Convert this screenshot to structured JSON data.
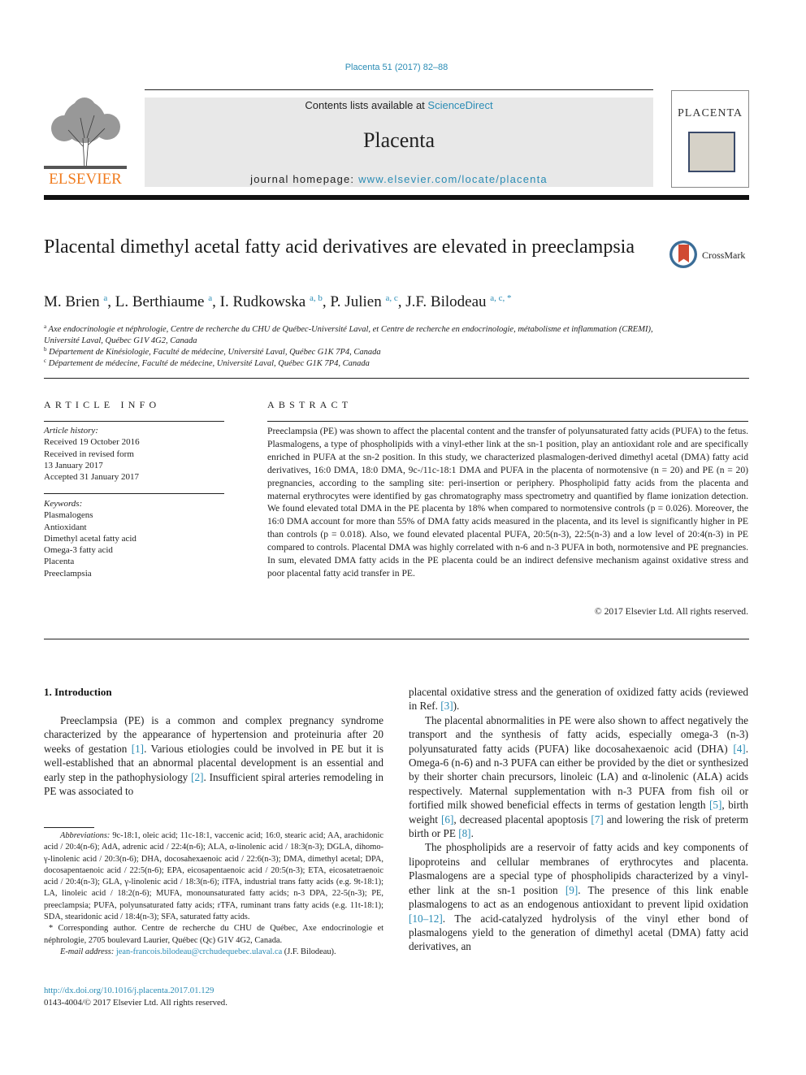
{
  "header": {
    "journal_ref": "Placenta 51 (2017) 82–88",
    "contents_prefix": "Contents lists available at ",
    "contents_link": "ScienceDirect",
    "journal_title": "Placenta",
    "homepage_prefix": "journal homepage: ",
    "homepage_link": "www.elsevier.com/locate/placenta",
    "publisher_logo": "ELSEVIER",
    "cover_title": "PLACENTA",
    "crossmark_label": "CrossMark"
  },
  "article": {
    "title": "Placental dimethyl acetal fatty acid derivatives are elevated in preeclampsia",
    "authors": [
      {
        "name": "M. Brien",
        "sup": "a"
      },
      {
        "name": "L. Berthiaume",
        "sup": "a"
      },
      {
        "name": "I. Rudkowska",
        "sup": "a, b"
      },
      {
        "name": "P. Julien",
        "sup": "a, c"
      },
      {
        "name": "J.F. Bilodeau",
        "sup": "a, c, *"
      }
    ],
    "affiliations": [
      {
        "mark": "a",
        "text": "Axe endocrinologie et néphrologie, Centre de recherche du CHU de Québec-Université Laval, et Centre de recherche en endocrinologie, métabolisme et inflammation (CREMI), Université Laval, Québec G1V 4G2, Canada"
      },
      {
        "mark": "b",
        "text": "Département de Kinésiologie, Faculté de médecine, Université Laval, Québec G1K 7P4, Canada"
      },
      {
        "mark": "c",
        "text": "Département de médecine, Faculté de médecine, Université Laval, Québec G1K 7P4, Canada"
      }
    ]
  },
  "article_info": {
    "heading": "ARTICLE INFO",
    "history_label": "Article history:",
    "history": [
      "Received 19 October 2016",
      "Received in revised form",
      "13 January 2017",
      "Accepted 31 January 2017"
    ],
    "keywords_label": "Keywords:",
    "keywords": [
      "Plasmalogens",
      "Antioxidant",
      "Dimethyl acetal fatty acid",
      "Omega-3 fatty acid",
      "Placenta",
      "Preeclampsia"
    ]
  },
  "abstract": {
    "heading": "ABSTRACT",
    "text": "Preeclampsia (PE) was shown to affect the placental content and the transfer of polyunsaturated fatty acids (PUFA) to the fetus. Plasmalogens, a type of phospholipids with a vinyl-ether link at the sn-1 position, play an antioxidant role and are specifically enriched in PUFA at the sn-2 position. In this study, we characterized plasmalogen-derived dimethyl acetal (DMA) fatty acid derivatives, 16:0 DMA, 18:0 DMA, 9c-/11c-18:1 DMA and PUFA in the placenta of normotensive (n = 20) and PE (n = 20) pregnancies, according to the sampling site: peri-insertion or periphery. Phospholipid fatty acids from the placenta and maternal erythrocytes were identified by gas chromatography mass spectrometry and quantified by flame ionization detection. We found elevated total DMA in the PE placenta by 18% when compared to normotensive controls (p = 0.026). Moreover, the 16:0 DMA account for more than 55% of DMA fatty acids measured in the placenta, and its level is significantly higher in PE than controls (p = 0.018). Also, we found elevated placental PUFA, 20:5(n-3), 22:5(n-3) and a low level of 20:4(n-3) in PE compared to controls. Placental DMA was highly correlated with n-6 and n-3 PUFA in both, normotensive and PE pregnancies. In sum, elevated DMA fatty acids in the PE placenta could be an indirect defensive mechanism against oxidative stress and poor placental fatty acid transfer in PE.",
    "copyright": "© 2017 Elsevier Ltd. All rights reserved."
  },
  "introduction": {
    "heading": "1.  Introduction",
    "left_col": {
      "p1_a": "Preeclampsia (PE) is a common and complex pregnancy syndrome characterized by the appearance of hypertension and proteinuria after 20 weeks of gestation ",
      "ref1": "[1]",
      "p1_b": ". Various etiologies could be involved in PE but it is well-established that an abnormal placental development is an essential and early step in the pathophysiology ",
      "ref2": "[2]",
      "p1_c": ". Insufficient spiral arteries remodeling in PE was associated to"
    },
    "right_col": {
      "p1_a": "placental oxidative stress and the generation of oxidized fatty acids (reviewed in Ref. ",
      "ref3": "[3]",
      "p1_b": ").",
      "p2_a": "The placental abnormalities in PE were also shown to affect negatively the transport and the synthesis of fatty acids, especially omega-3 (n-3) polyunsaturated fatty acids (PUFA) like docosahexaenoic acid (DHA) ",
      "ref4": "[4]",
      "p2_b": ". Omega-6 (n-6) and n-3 PUFA can either be provided by the diet or synthesized by their shorter chain precursors, linoleic (LA) and α-linolenic (ALA) acids respectively. Maternal supplementation with n-3 PUFA from fish oil or fortified milk showed beneficial effects in terms of gestation length ",
      "ref5": "[5]",
      "p2_c": ", birth weight ",
      "ref6": "[6]",
      "p2_d": ", decreased placental apoptosis ",
      "ref7": "[7]",
      "p2_e": " and lowering the risk of preterm birth or PE ",
      "ref8": "[8]",
      "p2_f": ".",
      "p3_a": "The phospholipids are a reservoir of fatty acids and key components of lipoproteins and cellular membranes of erythrocytes and placenta. Plasmalogens are a special type of phospholipids characterized by a vinyl-ether link at the sn-1 position ",
      "ref9": "[9]",
      "p3_b": ". The presence of this link enable plasmalogens to act as an endogenous antioxidant to prevent lipid oxidation ",
      "ref10": "[10–12]",
      "p3_c": ". The acid-catalyzed hydrolysis of the vinyl ether bond of plasmalogens yield to the generation of dimethyl acetal (DMA) fatty acid derivatives, an"
    }
  },
  "footnotes": {
    "abbrev_label": "Abbreviations:",
    "abbrev_text": " 9c-18:1, oleic acid; 11c-18:1, vaccenic acid; 16:0, stearic acid; AA, arachidonic acid / 20:4(n-6); AdA, adrenic acid / 22:4(n-6); ALA, α-linolenic acid / 18:3(n-3); DGLA, dihomo-γ-linolenic acid / 20:3(n-6); DHA, docosahexaenoic acid / 22:6(n-3); DMA, dimethyl acetal; DPA, docosapentaenoic acid / 22:5(n-6); EPA, eicosapentaenoic acid / 20:5(n-3); ETA, eicosatetraenoic acid / 20:4(n-3); GLA, γ-linolenic acid / 18:3(n-6); iTFA, industrial trans fatty acids (e.g. 9t-18:1); LA, linoleic acid / 18:2(n-6); MUFA, monounsaturated fatty acids; n-3 DPA, 22-5(n-3); PE, preeclampsia; PUFA, polyunsaturated fatty acids; rTFA, ruminant trans fatty acids (e.g. 11t-18:1); SDA, stearidonic acid / 18:4(n-3); SFA, saturated fatty acids.",
    "corresponding": "* Corresponding author. Centre de recherche du CHU de Québec, Axe endocrinologie et néphrologie, 2705 boulevard Laurier, Québec (Qc) G1V 4G2, Canada.",
    "email_label": "E-mail address:",
    "email": "jean-francois.bilodeau@crchudequebec.ulaval.ca",
    "email_suffix": " (J.F. Bilodeau)."
  },
  "doi": {
    "link": "http://dx.doi.org/10.1016/j.placenta.2017.01.129",
    "issn_line": "0143-4004/© 2017 Elsevier Ltd. All rights reserved."
  }
}
